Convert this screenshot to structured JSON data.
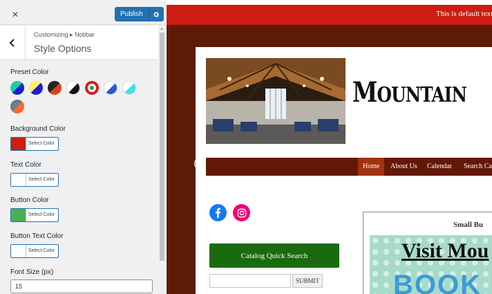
{
  "customizer": {
    "close_label": "×",
    "publish_label": "Publish",
    "breadcrumb": "Customizing ▸ Notibar",
    "section_title": "Style Options",
    "preset_label": "Preset Color",
    "presets": [
      {
        "a": "#1bd0a2",
        "b": "#1d1dd6"
      },
      {
        "a": "#f7f06e",
        "b": "#1d1dd6"
      },
      {
        "a": "#222222",
        "b": "#d8401f"
      },
      {
        "a": "#ffffff",
        "b": "#111111"
      },
      {
        "a": "#2e9e3e",
        "b": "#d61e1e"
      },
      {
        "a": "#ffffff",
        "b": "#1d5fd6"
      },
      {
        "a": "#ffffff",
        "b": "#3fe0f0"
      },
      {
        "a": "#6b7b8c",
        "b": "#f26b2c"
      }
    ],
    "background_color": {
      "label": "Background Color",
      "button": "Select Color",
      "value": "#cc1d12"
    },
    "text_color": {
      "label": "Text Color",
      "button": "Select Color",
      "value": "#ffffff"
    },
    "button_color": {
      "label": "Button Color",
      "button": "Select Color",
      "value": "#4caf50"
    },
    "button_text_color": {
      "label": "Button Text Color",
      "button": "Select Color",
      "value": "#ffffff"
    },
    "font_size": {
      "label": "Font Size (px)",
      "value": "15"
    }
  },
  "preview": {
    "notibar_text": "This is default text",
    "site_title_first": "M",
    "site_title_rest": "OUNTAIN",
    "nav": [
      "Home",
      "About Us",
      "Calendar",
      "Search Ca"
    ],
    "catalog_button": "Catalog Quick Search",
    "submit_label": "SUBMIT",
    "promo_heading": "Small Bu",
    "promo_text": "Visit Mou",
    "promo_book": "BOOK"
  }
}
